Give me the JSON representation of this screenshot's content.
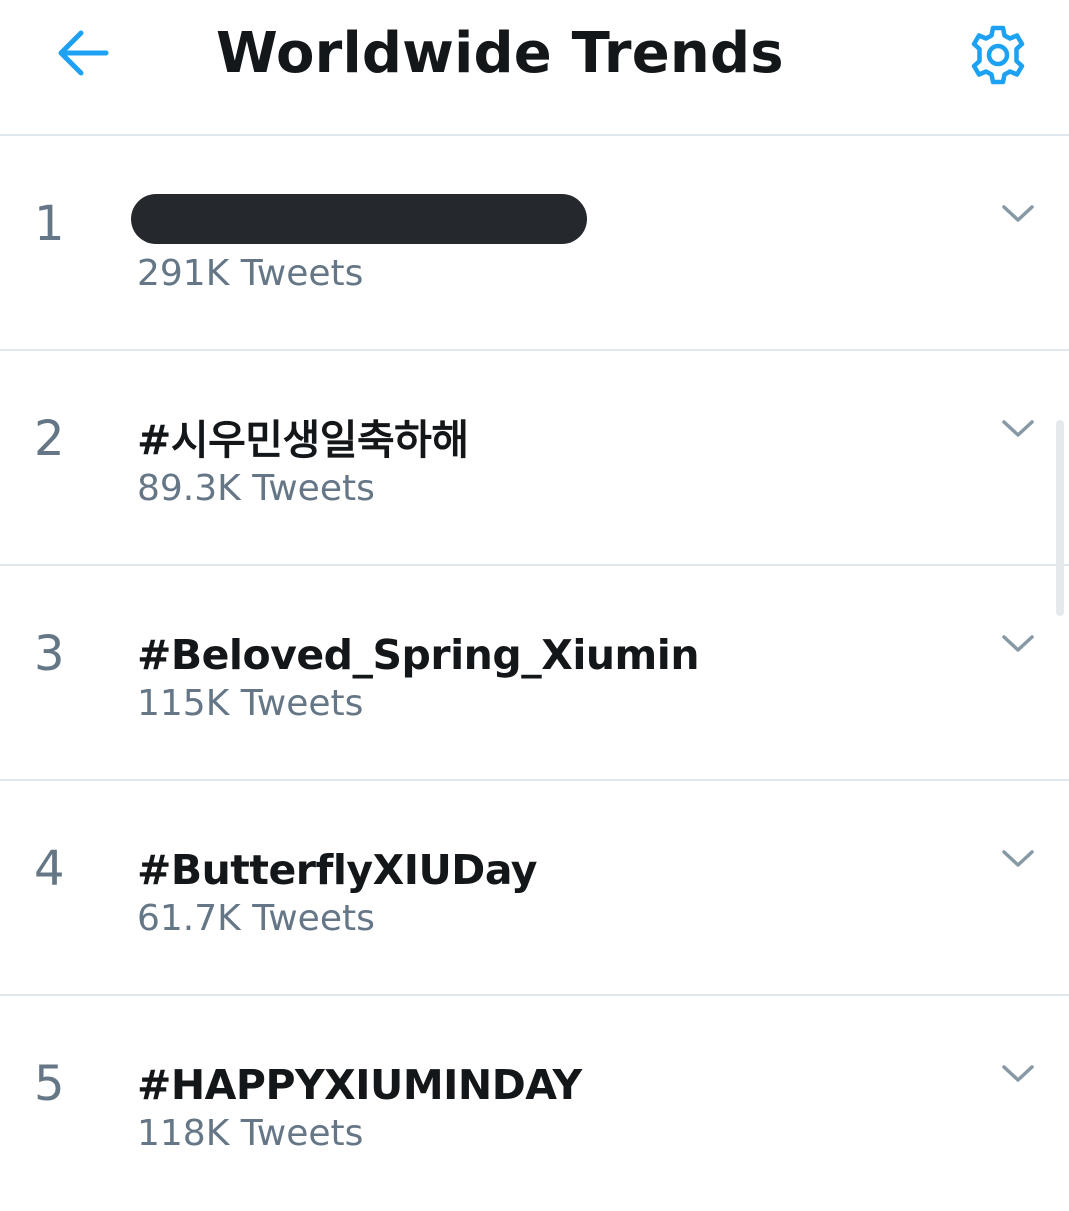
{
  "header": {
    "title": "Worldwide Trends",
    "back_icon": "arrow-left-icon",
    "settings_icon": "gear-icon"
  },
  "colors": {
    "accent": "#1da1f2",
    "primary_text": "#14171a",
    "secondary_text": "#657786",
    "divider": "#e1e8ed"
  },
  "trends": [
    {
      "rank": "1",
      "name": "",
      "tweets": "291K Tweets",
      "redacted": true
    },
    {
      "rank": "2",
      "name": "#시우민생일축하해",
      "tweets": "89.3K Tweets"
    },
    {
      "rank": "3",
      "name": "#Beloved_Spring_Xiumin",
      "tweets": "115K Tweets"
    },
    {
      "rank": "4",
      "name": "#ButterflyXIUDay",
      "tweets": "61.7K Tweets"
    },
    {
      "rank": "5",
      "name": "#HAPPYXIUMINDAY",
      "tweets": "118K Tweets"
    }
  ]
}
